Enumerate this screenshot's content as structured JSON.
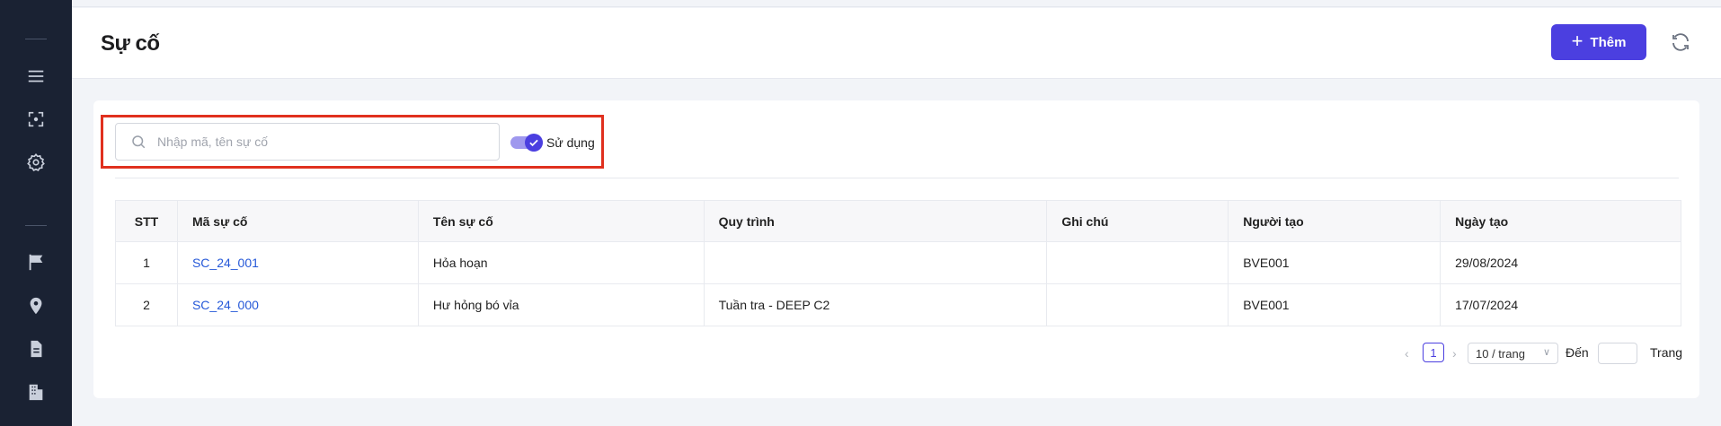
{
  "header": {
    "title": "Sự cố",
    "add_label": "Thêm"
  },
  "sidebar": {
    "icons": [
      "menu-icon",
      "focus-icon",
      "settings-icon",
      "flag-icon",
      "location-pin-icon",
      "document-icon",
      "building-icon"
    ]
  },
  "filters": {
    "search_placeholder": "Nhập mã, tên sự cố",
    "search_value": "",
    "toggle_label": "Sử dụng",
    "toggle_on": true
  },
  "table": {
    "columns": [
      "STT",
      "Mã sự cố",
      "Tên sự cố",
      "Quy trình",
      "Ghi chú",
      "Người tạo",
      "Ngày tạo"
    ],
    "rows": [
      {
        "stt": "1",
        "code": "SC_24_001",
        "name": "Hỏa hoạn",
        "process": "",
        "note": "",
        "creator": "BVE001",
        "created_at": "29/08/2024"
      },
      {
        "stt": "2",
        "code": "SC_24_000",
        "name": "Hư hỏng bó vỉa",
        "process": "Tuần tra - DEEP C2",
        "note": "",
        "creator": "BVE001",
        "created_at": "17/07/2024"
      }
    ]
  },
  "pagination": {
    "current_page": "1",
    "page_size": "10 / trang",
    "goto_label": "Đến",
    "goto_suffix": "Trang"
  },
  "colors": {
    "primary": "#4b3fe0",
    "sidebar": "#1a2233",
    "link": "#2558d8",
    "highlight": "#e0301e"
  }
}
